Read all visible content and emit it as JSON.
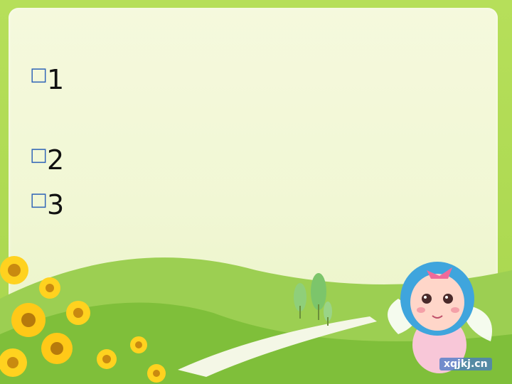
{
  "slide": {
    "title": "",
    "bullet_icon": "square-bullet",
    "items": [
      {
        "number": "1",
        "line1": "",
        "line2": ""
      },
      {
        "number": "2",
        "line1": ""
      },
      {
        "number": "3",
        "line1": ""
      }
    ],
    "watermark": "xqjkj.cn"
  },
  "colors": {
    "background": "#a8d64e",
    "panel": "#f3f8d8",
    "title": "#d7261d",
    "text": "#111111",
    "bullet": "#2e63b7"
  }
}
